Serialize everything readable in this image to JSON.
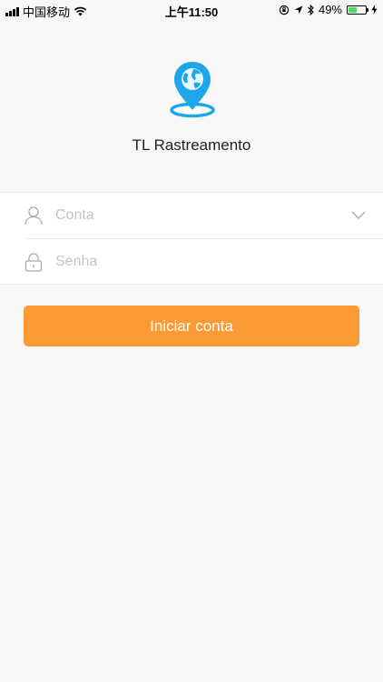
{
  "status_bar": {
    "carrier": "中国移动",
    "time": "上午11:50",
    "battery_percent": "49%",
    "battery_level": 0.49,
    "icons": [
      "signal-icon",
      "wifi-icon",
      "orientation-lock-icon",
      "location-icon",
      "bluetooth-icon",
      "battery-icon",
      "charging-icon"
    ]
  },
  "app": {
    "title": "TL Rastreamento",
    "logo_icon": "location-pin-globe-icon"
  },
  "form": {
    "account_placeholder": "Conta",
    "password_placeholder": "Senha",
    "account_icon": "user-icon",
    "password_icon": "lock-icon",
    "dropdown_icon": "chevron-down-icon"
  },
  "login_button": {
    "label": "Iniciar conta"
  },
  "colors": {
    "background": "#f7f7f7",
    "accent": "#fd9a35",
    "logo_blue": "#1ea6ea",
    "placeholder": "#c4c4c4",
    "battery_green": "#4cd964"
  }
}
